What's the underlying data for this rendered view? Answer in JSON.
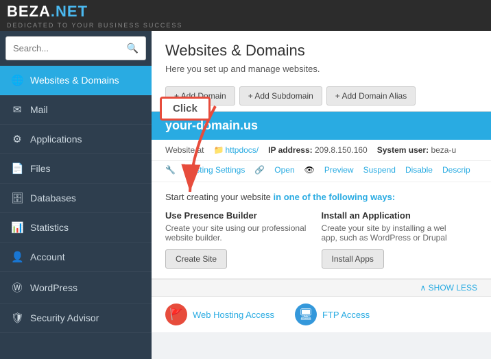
{
  "logo": {
    "beza": "BEZA",
    "dot": ".",
    "net": "NET",
    "tagline": "DEDICATED TO YOUR BUSINESS SUCCESS"
  },
  "search": {
    "placeholder": "Search..."
  },
  "sidebar": {
    "items": [
      {
        "id": "websites-domains",
        "label": "Websites & Domains",
        "icon": "🌐",
        "active": true
      },
      {
        "id": "mail",
        "label": "Mail",
        "icon": "✉",
        "active": false
      },
      {
        "id": "applications",
        "label": "Applications",
        "icon": "⚙",
        "active": false
      },
      {
        "id": "files",
        "label": "Files",
        "icon": "📄",
        "active": false
      },
      {
        "id": "databases",
        "label": "Databases",
        "icon": "🗄",
        "active": false
      },
      {
        "id": "statistics",
        "label": "Statistics",
        "icon": "📊",
        "active": false
      },
      {
        "id": "account",
        "label": "Account",
        "icon": "👤",
        "active": false
      },
      {
        "id": "wordpress",
        "label": "WordPress",
        "icon": "Ⓦ",
        "active": false
      },
      {
        "id": "security-advisor",
        "label": "Security Advisor",
        "icon": "🛡",
        "active": false
      }
    ]
  },
  "content": {
    "title": "Websites & Domains",
    "description": "Here you set up and manage websites.",
    "buttons": {
      "add_domain": "+ Add Domain",
      "add_subdomain": "+ Add Subdomain",
      "add_domain_alias": "+ Add Domain Alias"
    },
    "domain": {
      "name": "your-domain.us",
      "website_at": "Website at",
      "folder": "httpdocs/",
      "ip_label": "IP address:",
      "ip": "209.8.150.160",
      "system_user_label": "System user:",
      "system_user": "beza-u",
      "links": [
        "Hosting Settings",
        "Open",
        "Preview",
        "Suspend",
        "Disable",
        "Descrip"
      ]
    },
    "create_section": {
      "intro": "Start creating your website in one of the following ways:",
      "col1": {
        "title": "Use Presence Builder",
        "desc": "Create your site using our professional website builder.",
        "btn": "Create Site"
      },
      "col2": {
        "title": "Install an Application",
        "desc": "Create your site by installing a wel app, such as WordPress or Drupal",
        "btn": "Install Apps"
      }
    },
    "show_less": "∧  SHOW LESS",
    "bottom_links": [
      {
        "id": "web-hosting",
        "label": "Web Hosting Access",
        "icon_type": "hosting"
      },
      {
        "id": "ftp-access",
        "label": "FTP Access",
        "icon_type": "ftp"
      }
    ]
  },
  "overlay": {
    "click_label": "Click"
  }
}
